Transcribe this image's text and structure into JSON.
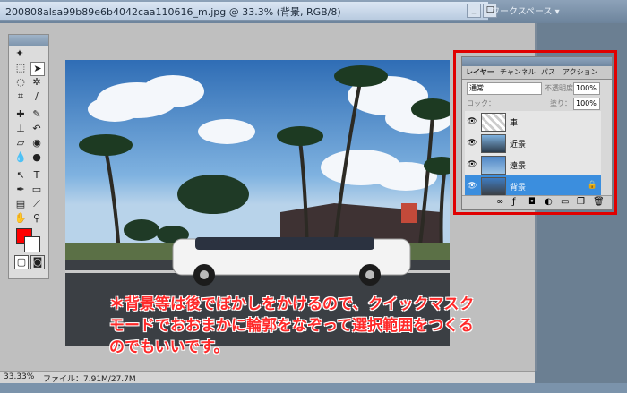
{
  "window": {
    "title": "200808alsa99b89e6b4042caa110616_m.jpg @ 33.3% (背景, RGB/8)",
    "right_tabs": "ワークスペース ▾"
  },
  "tools": {
    "items": [
      "marquee-tool",
      "move-tool",
      "lasso-tool",
      "magic-wand-tool",
      "crop-tool",
      "slice-tool",
      "healing-brush-tool",
      "brush-tool",
      "clone-stamp-tool",
      "history-brush-tool",
      "eraser-tool",
      "fill-tool",
      "blur-tool",
      "dodge-tool",
      "path-select-tool",
      "type-tool",
      "pen-tool",
      "shape-tool",
      "notes-tool",
      "eyedropper-tool",
      "hand-tool",
      "zoom-tool"
    ],
    "foreground_color": "#ff0000",
    "background_color": "#ffffff"
  },
  "status": {
    "zoom": "33.33%",
    "file_info": "ファイル：7.91M/27.7M"
  },
  "layers_panel": {
    "tabs": [
      "レイヤー",
      "チャンネル",
      "パス",
      "アクション"
    ],
    "blend_mode": "通常",
    "opacity_label": "不透明度：",
    "opacity_value": "100%",
    "lock_label": "ロック：",
    "fill_label": "塗り：",
    "fill_value": "100%",
    "layers": [
      {
        "name": "車",
        "visible": true,
        "selected": false
      },
      {
        "name": "近景",
        "visible": true,
        "selected": false
      },
      {
        "name": "遠景",
        "visible": true,
        "selected": false
      },
      {
        "name": "背景",
        "visible": true,
        "selected": true
      }
    ]
  },
  "annotation": {
    "line1": "＊背景等は後でぼかしをかけるので、クイックマスク",
    "line2": "モードでおおまかに輪郭をなぞって選択範囲をつくる",
    "line3": "のでもいいです。"
  }
}
